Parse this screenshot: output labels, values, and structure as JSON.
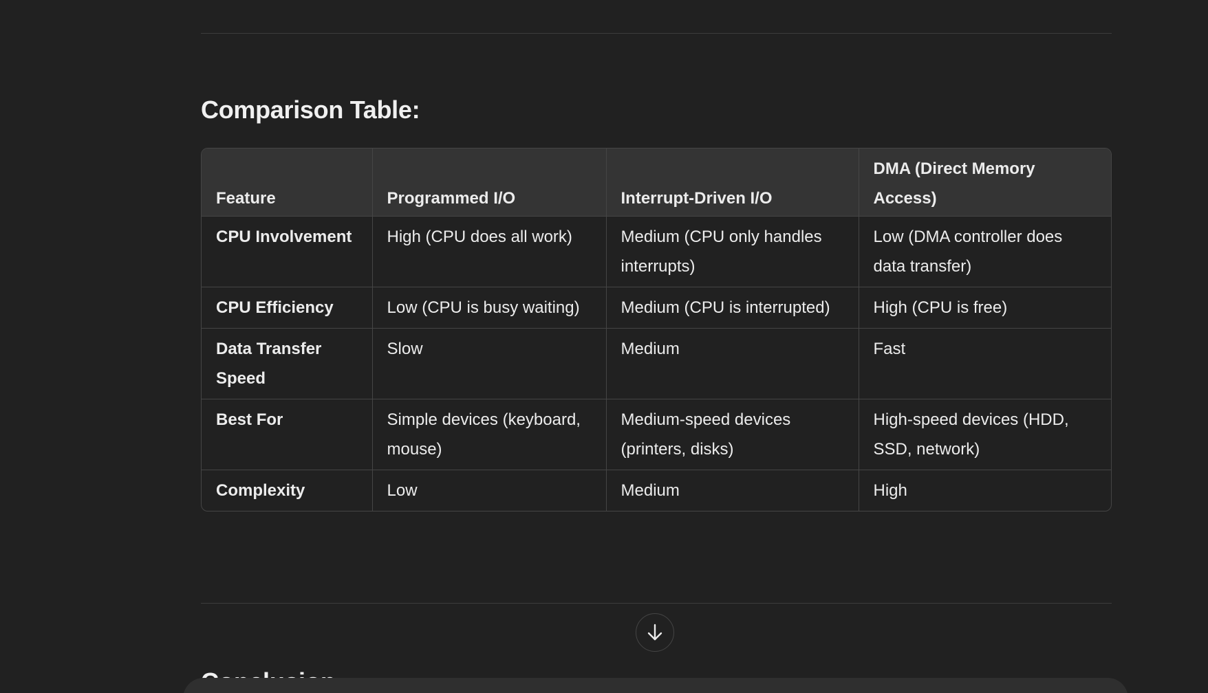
{
  "section": {
    "heading": "Comparison Table:"
  },
  "table": {
    "headers": [
      "Feature",
      "Programmed I/O",
      "Interrupt-Driven I/O",
      "DMA (Direct Memory Access)"
    ],
    "rows": [
      [
        "CPU Involvement",
        "High (CPU does all work)",
        "Medium (CPU only handles interrupts)",
        "Low (DMA controller does data transfer)"
      ],
      [
        "CPU Efficiency",
        "Low (CPU is busy waiting)",
        "Medium (CPU is interrupted)",
        "High (CPU is free)"
      ],
      [
        "Data Transfer Speed",
        "Slow",
        "Medium",
        "Fast"
      ],
      [
        "Best For",
        "Simple devices (keyboard, mouse)",
        "Medium-speed devices (printers, disks)",
        "High-speed devices (HDD, SSD, network)"
      ],
      [
        "Complexity",
        "Low",
        "Medium",
        "High"
      ]
    ]
  },
  "next_section": {
    "heading": "Conclusion"
  },
  "scroll_button": {
    "icon": "arrow-down-icon"
  }
}
